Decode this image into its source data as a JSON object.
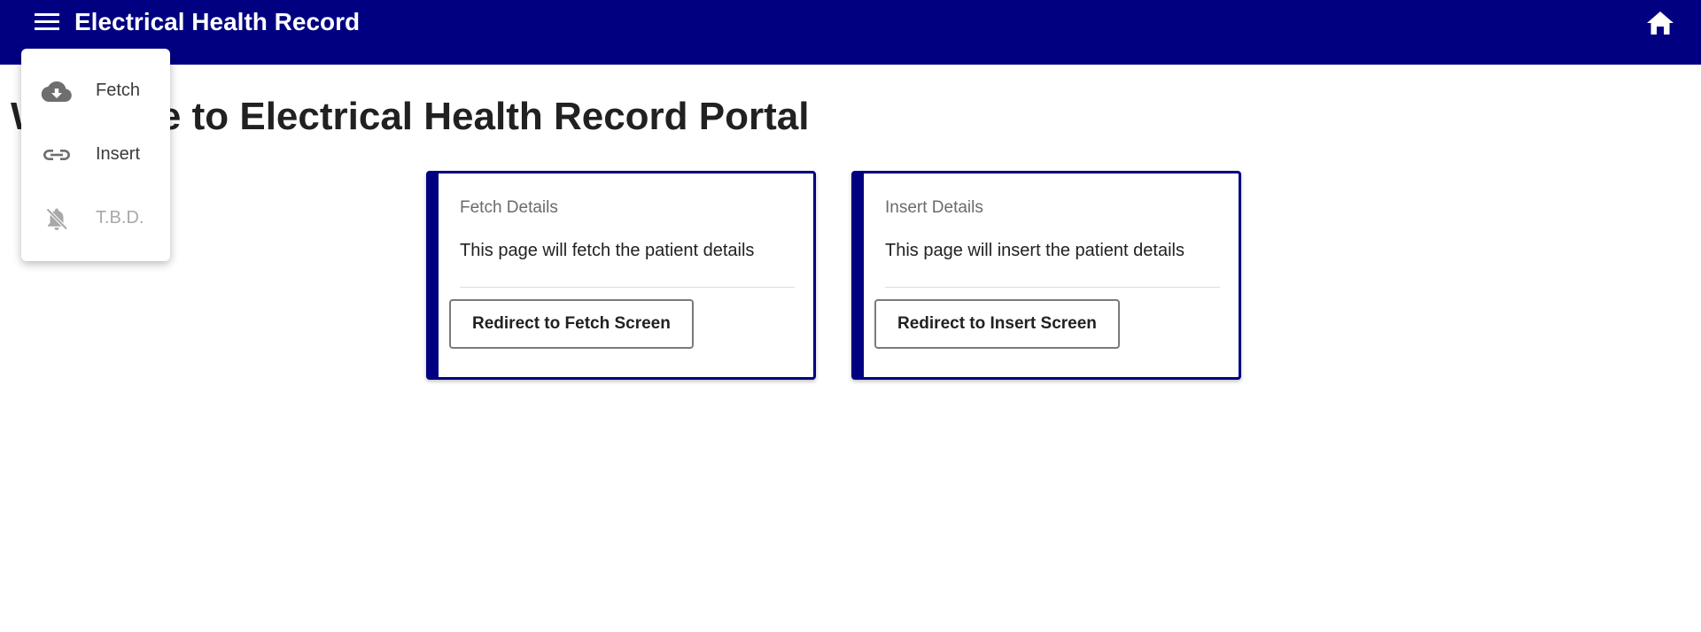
{
  "header": {
    "title": "Electrical Health Record",
    "menu_icon": "menu-icon",
    "home_icon": "home-icon",
    "background_color": "#000080"
  },
  "main": {
    "welcome_heading": "Welcome to Electrical Health Record Portal"
  },
  "cards": [
    {
      "title": "Fetch Details",
      "text": "This page will fetch the patient details",
      "button_label": "Redirect to Fetch Screen"
    },
    {
      "title": "Insert Details",
      "text": "This page will insert the patient details",
      "button_label": "Redirect to Insert Screen"
    }
  ],
  "menu": {
    "items": [
      {
        "label": "Fetch",
        "icon": "cloud-download-icon",
        "disabled": false
      },
      {
        "label": "Insert",
        "icon": "link-icon",
        "disabled": false
      },
      {
        "label": "T.B.D.",
        "icon": "notifications-off-icon",
        "disabled": true
      }
    ]
  }
}
